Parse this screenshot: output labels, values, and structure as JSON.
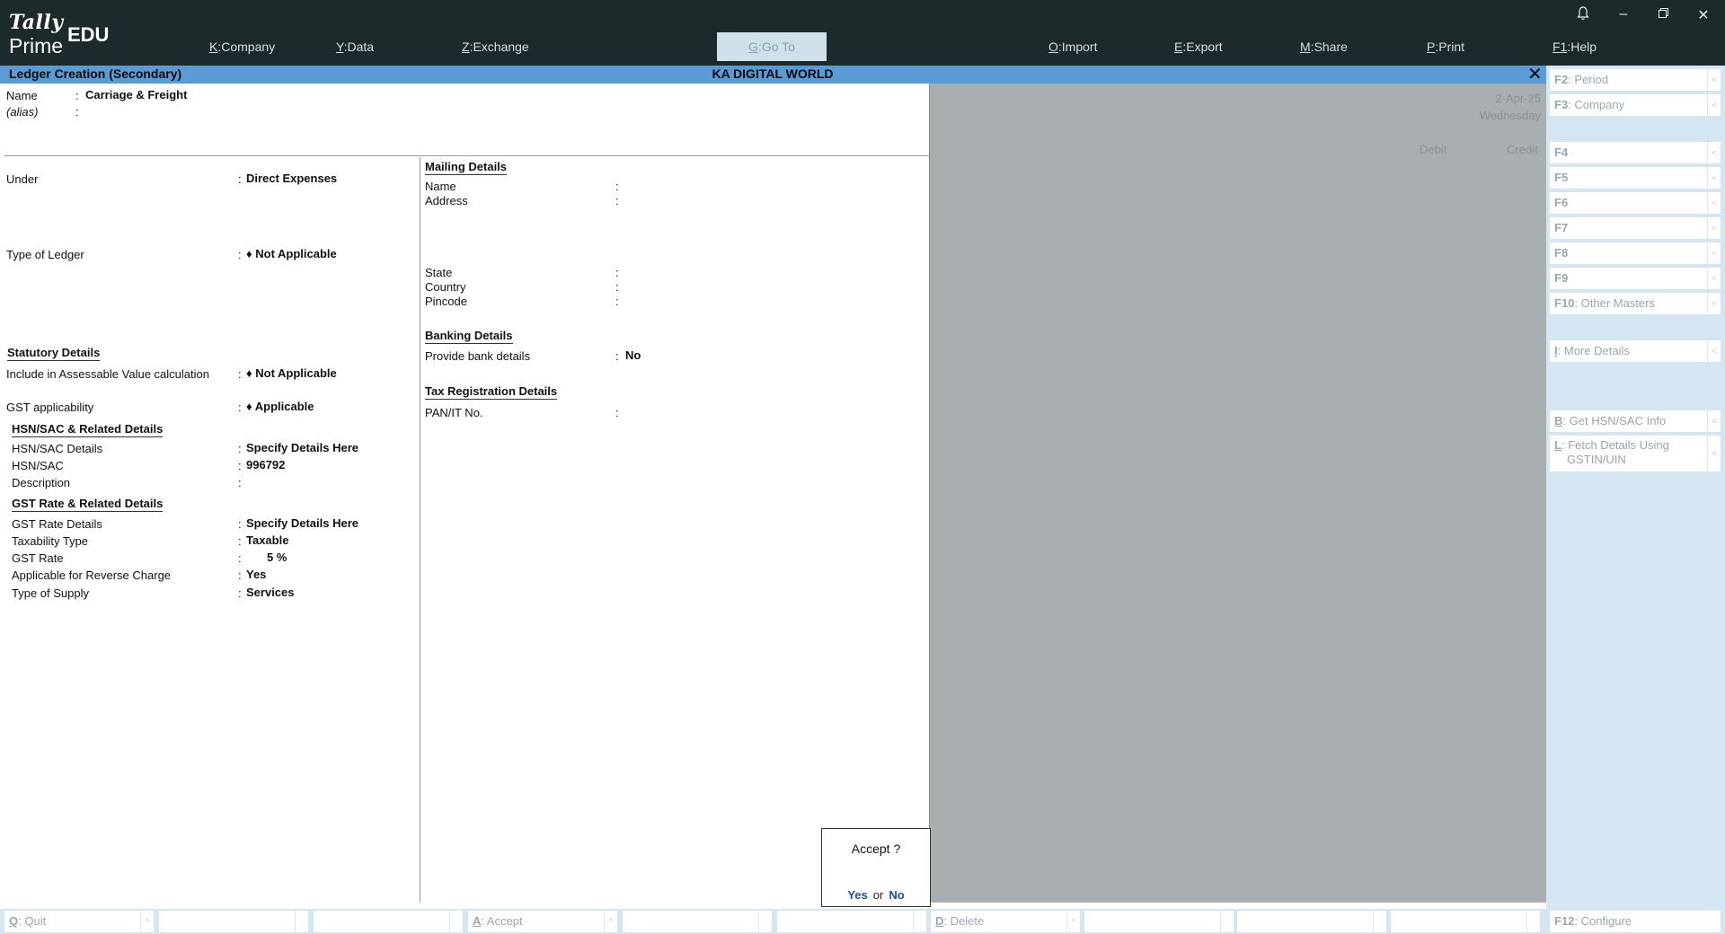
{
  "app": {
    "logo_top": "Tally",
    "logo_bottom": "Prime",
    "edition": "EDU"
  },
  "topmenu": [
    {
      "key": "K",
      "label": "Company"
    },
    {
      "key": "Y",
      "label": "Data"
    },
    {
      "key": "Z",
      "label": "Exchange"
    },
    {
      "key": "G",
      "label": "Go To"
    },
    {
      "key": "O",
      "label": "Import"
    },
    {
      "key": "E",
      "label": "Export"
    },
    {
      "key": "M",
      "label": "Share"
    },
    {
      "key": "P",
      "label": "Print"
    },
    {
      "key": "F1",
      "label": "Help"
    }
  ],
  "titlebar": {
    "screen": "Ledger Creation (Secondary)",
    "company": "KA DIGITAL WORLD",
    "close": "✕"
  },
  "ledger": {
    "name_label": "Name",
    "name_value": "Carriage & Freight",
    "alias_label": "(alias)"
  },
  "left": {
    "under_label": "Under",
    "under_value": "Direct Expenses",
    "type_label": "Type of Ledger",
    "type_value": "Not Applicable",
    "statutory_title": "Statutory Details",
    "assessable_label": "Include in Assessable Value calculation",
    "assessable_value": "Not Applicable",
    "gst_app_label": "GST applicability",
    "gst_app_value": "Applicable",
    "hsn_section": "HSN/SAC & Related Details",
    "hsn_details_label": "HSN/SAC Details",
    "hsn_details_value": "Specify Details Here",
    "hsn_label": "HSN/SAC",
    "hsn_value": "996792",
    "desc_label": "Description",
    "gst_rate_section": "GST Rate & Related Details",
    "gst_rate_details_label": "GST Rate Details",
    "gst_rate_details_value": "Specify Details Here",
    "taxability_label": "Taxability Type",
    "taxability_value": "Taxable",
    "gst_rate_label": "GST Rate",
    "gst_rate_value": "5 %",
    "reverse_label": "Applicable for Reverse Charge",
    "reverse_value": "Yes",
    "supply_label": "Type of Supply",
    "supply_value": "Services"
  },
  "right": {
    "mailing_title": "Mailing Details",
    "name_label": "Name",
    "address_label": "Address",
    "state_label": "State",
    "country_label": "Country",
    "pincode_label": "Pincode",
    "banking_title": "Banking Details",
    "bank_label": "Provide bank details",
    "bank_value": "No",
    "tax_title": "Tax Registration Details",
    "pan_label": "PAN/IT No."
  },
  "background": {
    "date": "2-Apr-25",
    "day": "Wednesday",
    "debit": "Debit",
    "credit": "Credit"
  },
  "dialog": {
    "question": "Accept ?",
    "yes": "Yes",
    "or": "or",
    "no": "No"
  },
  "rightbuttons": [
    {
      "key": "F2",
      "label": "Period"
    },
    {
      "key": "F3",
      "label": "Company"
    },
    {
      "key": "F4",
      "label": ""
    },
    {
      "key": "F5",
      "label": ""
    },
    {
      "key": "F6",
      "label": ""
    },
    {
      "key": "F7",
      "label": ""
    },
    {
      "key": "F8",
      "label": ""
    },
    {
      "key": "F9",
      "label": ""
    },
    {
      "key": "F10",
      "label": "Other Masters"
    },
    {
      "key": "I",
      "label": "More Details"
    },
    {
      "key": "B",
      "label": "Get HSN/SAC Info"
    },
    {
      "key": "L",
      "label": "Fetch Details Using",
      "label2": "GSTIN/UIN"
    }
  ],
  "bottombuttons": [
    {
      "key": "Q",
      "label": "Quit"
    },
    {
      "key": "A",
      "label": "Accept"
    },
    {
      "key": "D",
      "label": "Delete"
    }
  ],
  "configure": {
    "key": "F12",
    "label": "Configure"
  }
}
